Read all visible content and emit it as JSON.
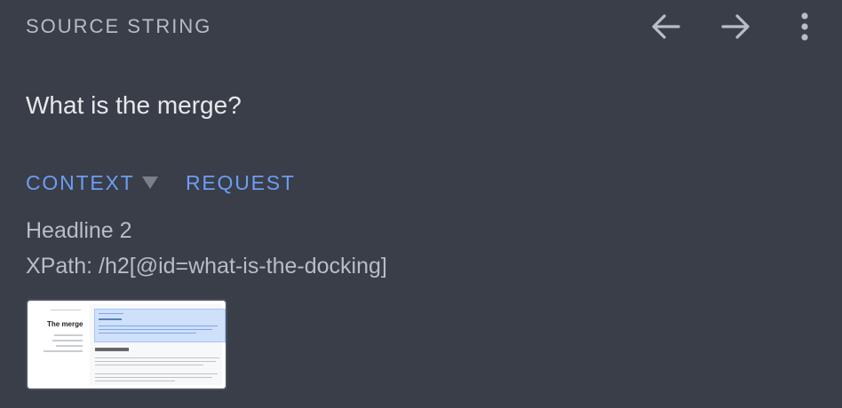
{
  "header": {
    "title": "SOURCE STRING",
    "back_icon": "arrow-left-icon",
    "forward_icon": "arrow-right-icon",
    "menu_icon": "more-vert-icon"
  },
  "source_string": "What is the merge?",
  "tabs": [
    {
      "label": "CONTEXT",
      "has_dropdown": true
    },
    {
      "label": "REQUEST"
    }
  ],
  "context": {
    "element_type": "Headline 2",
    "xpath": "XPath: /h2[@id=what-is-the-docking]"
  },
  "screenshot": {
    "page_title": "The merge"
  },
  "colors": {
    "background": "#393e48",
    "accent": "#6c9df5",
    "text_primary": "#e6e8eb",
    "text_secondary": "#b9bdc4"
  }
}
